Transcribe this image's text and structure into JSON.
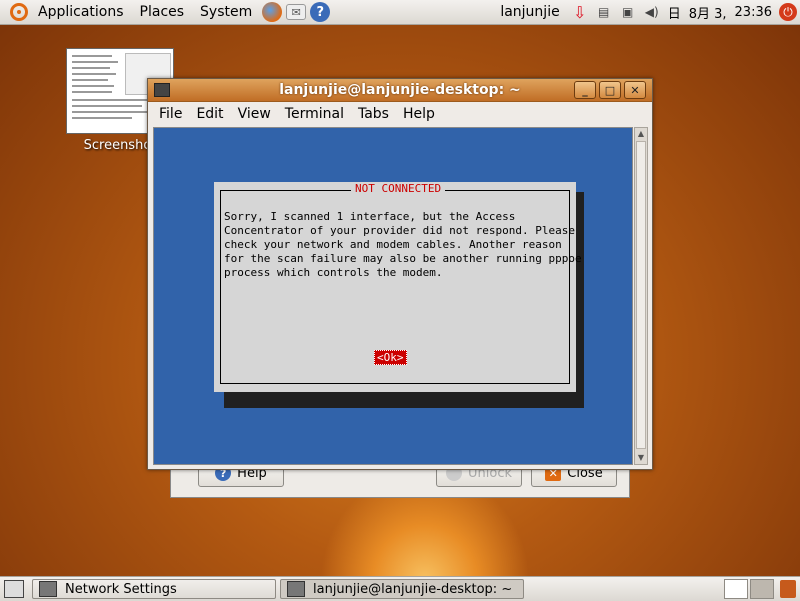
{
  "top_panel": {
    "menus": [
      "Applications",
      "Places",
      "System"
    ],
    "launchers": [
      "firefox-icon",
      "mail-icon",
      "help-icon"
    ],
    "user": "lanjunjie",
    "date": "8月 3,",
    "time": "23:36",
    "date_prefix": "日"
  },
  "desktop": {
    "icon_label": "Screenshot"
  },
  "background_dialog": {
    "help_label": "Help",
    "unlock_label": "Unlock",
    "close_label": "Close"
  },
  "terminal": {
    "title": "lanjunjie@lanjunjie-desktop: ~",
    "menu": [
      "File",
      "Edit",
      "View",
      "Terminal",
      "Tabs",
      "Help"
    ],
    "dialog": {
      "title": "NOT CONNECTED",
      "message": "Sorry, I scanned 1 interface, but the Access\nConcentrator of your provider did not respond. Please\ncheck your network and modem cables. Another reason\nfor the scan failure may also be another running pppoe\nprocess which controls the modem.",
      "ok_label": "<Ok>"
    }
  },
  "bottom_panel": {
    "tasks": [
      {
        "label": "Network Settings",
        "active": false
      },
      {
        "label": "lanjunjie@lanjunjie-desktop: ~",
        "active": true
      }
    ]
  },
  "colors": {
    "terminal_bg": "#3163aa",
    "dialog_bg": "#d6d6d6",
    "accent_red": "#cc0000",
    "titlebar": "#c06d25"
  }
}
